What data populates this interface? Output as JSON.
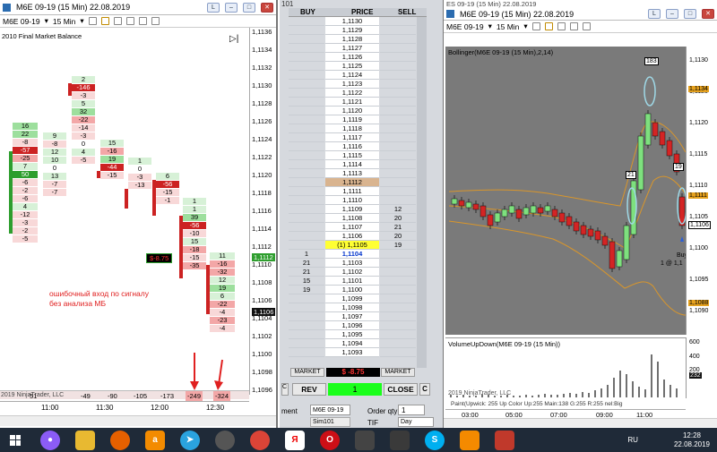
{
  "left_window": {
    "title": "M6E 09-19 (15 Min) 22.08.2019",
    "toolbar_label": "M6E 09-19",
    "interval": "15 Min",
    "indicator": "2010 Final Market Balance",
    "ninja_label": "2019 NinjaTrader, LLC",
    "price_axis": [
      "1,1136",
      "1,1134",
      "1,1132",
      "1,1130",
      "1,1128",
      "1,1126",
      "1,1124",
      "1,1122",
      "1,1120",
      "1,1118",
      "1,1116",
      "1,1114",
      "1,1112",
      "1,1110",
      "1,1108",
      "1,1106",
      "1,1104",
      "1,1102",
      "1,1100",
      "1,1098",
      "1,1096"
    ],
    "current_price": "1,1106",
    "highlight_price": "1,1112",
    "time_axis": [
      "11:00",
      "11:30",
      "12:00",
      "12:30"
    ],
    "delta_row": [
      "-49",
      "-90",
      "-105",
      "-173",
      "-249",
      "-324"
    ],
    "delta_first": "51",
    "position_tag": "$-8.75",
    "annotation": "ошибочный вход по сигналу\nбез анализа МБ",
    "cluster_col1": [
      "16",
      "22",
      "-8",
      "-57",
      "-25",
      "7",
      "50",
      "-6",
      "-2",
      "-6",
      "4",
      "-12",
      "-3",
      "-2",
      "-5"
    ],
    "cluster_col2": [
      "9",
      "-8",
      "12",
      "10",
      "0",
      "13",
      "-7",
      "-7"
    ],
    "cluster_col3": [
      "2",
      "-146",
      "-3",
      "5",
      "32",
      "-22",
      "-14",
      "-3",
      "0",
      "4",
      "-5"
    ],
    "cluster_col4": [
      "15",
      "-16",
      "19",
      "-44",
      "-15"
    ],
    "cluster_col5": [
      "1",
      "0",
      "-3",
      "-13"
    ],
    "cluster_col6": [
      "6",
      "-56",
      "-15",
      "-1"
    ],
    "cluster_col7": [
      "1",
      "1",
      "39",
      "-56",
      "-10",
      "15",
      "-18",
      "-15",
      "-35"
    ],
    "cluster_col8": [
      "11",
      "-16",
      "-32",
      "12",
      "19",
      "6",
      "-22",
      "-4",
      "-23",
      "-4"
    ]
  },
  "dom": {
    "title": "101",
    "headers": {
      "buy": "BUY",
      "price": "PRICE",
      "sell": "SELL"
    },
    "prices": [
      "1,1130",
      "1,1129",
      "1,1128",
      "1,1127",
      "1,1126",
      "1,1125",
      "1,1124",
      "1,1123",
      "1,1122",
      "1,1121",
      "1,1120",
      "1,1119",
      "1,1118",
      "1,1117",
      "1,1116",
      "1,1115",
      "1,1114",
      "1,1113",
      "1,1112",
      "1,1111",
      "1,1110",
      "1,1109",
      "1,1108",
      "1,1107",
      "1,1106",
      "(1) 1,1105",
      "1,1104",
      "1,1103",
      "1,1102",
      "1,1101",
      "1,1100",
      "1,1099",
      "1,1098",
      "1,1097",
      "1,1096",
      "1,1095",
      "1,1094",
      "1,1093"
    ],
    "buy": [
      "",
      "",
      "",
      "",
      "",
      "",
      "",
      "",
      "",
      "",
      "",
      "",
      "",
      "",
      "",
      "",
      "",
      "",
      "",
      "",
      "",
      "",
      "",
      "",
      "",
      "",
      "1",
      "21",
      "21",
      "15",
      "19",
      "",
      "",
      "",
      "",
      "",
      "",
      ""
    ],
    "sell": [
      "",
      "",
      "",
      "",
      "",
      "",
      "",
      "",
      "",
      "",
      "",
      "",
      "",
      "",
      "",
      "",
      "",
      "",
      "",
      "",
      "",
      "12",
      "20",
      "21",
      "20",
      "19",
      "",
      "",
      "",
      "",
      "",
      "",
      "",
      "",
      "",
      "",
      "",
      ""
    ],
    "market_left": "MARKET",
    "market_right": "MARKET",
    "pnl": "$ -8.75",
    "rev": "REV",
    "qty": "1",
    "close": "CLOSE",
    "c_btn": "C",
    "instrument_label": "ment",
    "instrument_value": "M6E 09-19",
    "account_value": "Sim101",
    "order_qty_label": "Order qty",
    "order_qty_value": "1",
    "tif_label": "TIF",
    "tif_value": "Day"
  },
  "right_window": {
    "title": "M6E 09-19 (15 Min) 22.08.2019",
    "title_prefix": "ES 09-19 (15 Min) 22.08.2019",
    "toolbar_label": "M6E 09-19",
    "interval": "15 Min",
    "indicator_top": "Bollinger(M6E 09-19 (15 Min),2,14)",
    "indicator_bottom": "VolumeUpDown(M6E 09-19 (15 Min))",
    "price_axis": [
      "1,1130",
      "1,1125",
      "1,1120",
      "1,1115",
      "1,1110",
      "1,1105",
      "1,1100",
      "1,1095",
      "1,1090"
    ],
    "price_tags": [
      "1,1134",
      "1,1111",
      "1,1106",
      "1,1088"
    ],
    "vol_axis": [
      "600",
      "400",
      "200"
    ],
    "vol_value": "232",
    "time_axis": [
      "03:00",
      "05:00",
      "07:00",
      "09:00",
      "11:00"
    ],
    "labels": [
      "183",
      "21",
      "19"
    ],
    "buy_label": "Buy",
    "buy_qty": "1 @ 1,1",
    "ninja_label": "2019 NinjaTrader, LLC",
    "bottom_text": "Paint(Upwick: 255 Up Color Up:255 Main:138 G:255 R:255 nel:Big"
  },
  "taskbar": {
    "lang": "RU",
    "time": "12:28",
    "date": "22.08.2019"
  },
  "colors": {
    "bull": "#2e9e2e",
    "bear": "#cc2222",
    "chart_bg": "#7a7a7a",
    "bollinger": "#d9962b"
  }
}
